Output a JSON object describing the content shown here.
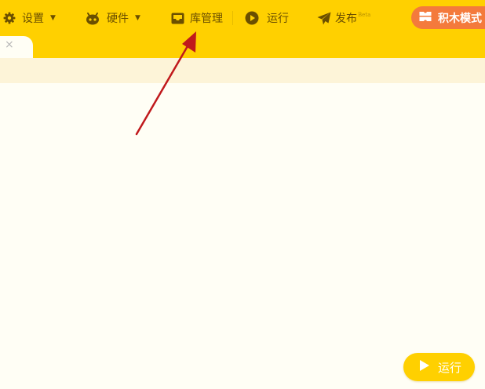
{
  "toolbar": {
    "settings_label": "设置",
    "hardware_label": "硬件",
    "library_label": "库管理",
    "run_label": "运行",
    "publish_label": "发布",
    "publish_badge": "Beta",
    "mode_label": "积木模式",
    "icons": {
      "settings": "gear-icon",
      "hardware": "robot-icon",
      "library": "inbox-icon",
      "run": "play-circle-icon",
      "publish": "paper-plane-icon",
      "mode": "blocks-icon"
    }
  },
  "tabs": {
    "close_glyph": "×"
  },
  "run_button": {
    "label": "运行",
    "icon": "play-icon"
  },
  "colors": {
    "toolbar_bg": "#ffd000",
    "toolbar_text": "#6b4f00",
    "mode_button_bg": "#f47a3c",
    "annotation_arrow": "#c0191c",
    "workspace_bg": "#fffef5"
  }
}
